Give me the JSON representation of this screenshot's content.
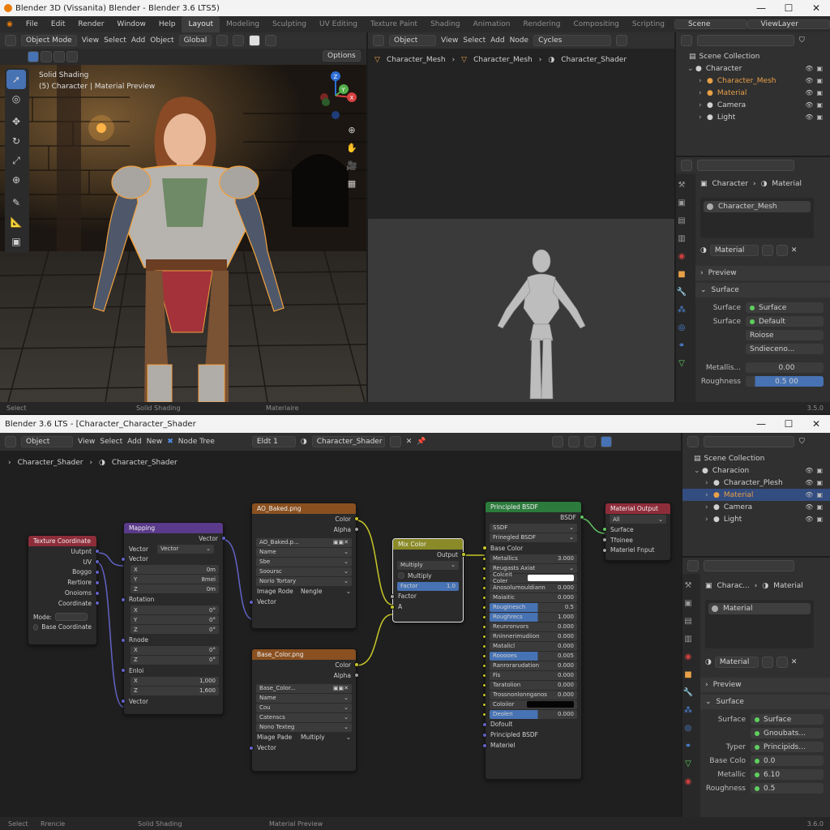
{
  "window1": {
    "title": "Blender 3D (Vissanita) Blender - Blender 3.6 LTS5)",
    "menu": [
      "File",
      "Edit",
      "Render",
      "Window",
      "Help"
    ],
    "workspaces": [
      "Layout",
      "Modeling",
      "Sculpting",
      "UV Editing",
      "Texture Paint",
      "Shading",
      "Animation",
      "Rendering",
      "Compositing",
      "Scripting"
    ],
    "scene": "Scene",
    "view_layer": "ViewLayer",
    "viewport": {
      "mode": "Object Mode",
      "menus": [
        "View",
        "Select",
        "Add",
        "Object"
      ],
      "transform": "Global",
      "options": "Options",
      "overlay_line1": "Solid Shading",
      "overlay_line2": "(5) Character | Material Preview",
      "gizmo_axes": [
        "Z",
        "Y",
        "X"
      ]
    },
    "shader_editor": {
      "mode": "Object",
      "menus": [
        "View",
        "Select",
        "Add",
        "Node"
      ],
      "engine": "Cycles",
      "breadcrumb": [
        "Character_Mesh",
        "Character_Mesh",
        "Character_Shader"
      ]
    },
    "outliner": {
      "title": "Scene Collection",
      "items": [
        {
          "label": "Character",
          "color": "#d0d0d0",
          "indent": 0
        },
        {
          "label": "Character_Mesh",
          "color": "#e8a048",
          "indent": 1
        },
        {
          "label": "Material",
          "color": "#e8a048",
          "indent": 1
        },
        {
          "label": "Camera",
          "color": "#d0d0d0",
          "indent": 1
        },
        {
          "label": "Light",
          "color": "#d0d0d0",
          "indent": 1
        }
      ]
    },
    "properties": {
      "breadcrumb": [
        "Character",
        "Material"
      ],
      "slot": "Character_Mesh",
      "material_name": "Material",
      "preview": "Preview",
      "surface_section": "Surface",
      "rows": [
        {
          "label": "Surface",
          "value": "Surface",
          "dot": true
        },
        {
          "label": "Surface",
          "value": "Default",
          "dot": true
        },
        {
          "label": "",
          "value": "Roiose",
          "dot": false
        },
        {
          "label": "",
          "value": "Sndieceno...",
          "dot": false
        }
      ],
      "metallic_label": "Metallis...",
      "metallic_value": "0.00",
      "roughness_label": "Roughness",
      "roughness_value": "0.5 00"
    },
    "status": {
      "left": "Select",
      "mid": "Solid Shading",
      "right": "Materiaire",
      "version": "3.5.0"
    }
  },
  "window2": {
    "title": "Blender 3.6 LTS - [Character_Character_Shader",
    "header": {
      "mode": "Object",
      "menus": [
        "View",
        "Select",
        "Add",
        "New"
      ],
      "node_tree": "Node Tree",
      "slot": "Eldt 1",
      "material": "Character_Shader"
    },
    "breadcrumb": [
      "Character_Shader",
      "Character_Shader"
    ],
    "nodes": {
      "texcoord": {
        "title": "Texture Coordinate",
        "outputs": [
          "Uutpnt",
          "UV",
          "Boggo",
          "Rertiore",
          "Onoioms",
          "Coordinate"
        ],
        "mode_label": "Mode:",
        "checkbox": "Base Coordinate"
      },
      "mapping": {
        "title": "Mapping",
        "out": "Vector",
        "type_label": "Vector",
        "type_value": "Vector",
        "vector_label": "Vector",
        "loc": [
          {
            "k": "X",
            "v": "0m"
          },
          {
            "k": "Y",
            "v": "8mei"
          },
          {
            "k": "Z",
            "v": "0m"
          }
        ],
        "rot_label": "Rotation",
        "rot": [
          {
            "k": "X",
            "v": "0°"
          },
          {
            "k": "Y",
            "v": "0°"
          },
          {
            "k": "Z",
            "v": "0°"
          }
        ],
        "scl_label": "Rnode",
        "scl": [
          {
            "k": "X",
            "v": "0°"
          },
          {
            "k": "Z",
            "v": "0°"
          }
        ],
        "extra_label": "Enloi",
        "extra": [
          {
            "k": "X",
            "v": "1,000"
          },
          {
            "k": "Z",
            "v": "1,600"
          }
        ],
        "in": "Vector"
      },
      "ao": {
        "title": "AO_Baked.png",
        "outputs": [
          "Color",
          "Alpha"
        ],
        "image": "AO_Baked.p...",
        "fields": [
          "Name",
          "Sbe",
          "Sooursc",
          "Norio Tortary"
        ],
        "proj_label": "Image Rode",
        "proj_value": "Nengle",
        "in": "Vector"
      },
      "base": {
        "title": "Base_Color.png",
        "outputs": [
          "Color",
          "Alpha"
        ],
        "image": "Base_Color...",
        "fields": [
          "Name",
          "Cou",
          "Catenscs",
          "Nono Texteg"
        ],
        "proj_label": "Miage Pade",
        "proj_value": "Multiply",
        "in": "Vector"
      },
      "mix": {
        "title": "Mix Color",
        "out": "Output",
        "blend": "Multiply",
        "clamp": "Multiply",
        "factor_label": "Factor",
        "factor_value": "1.0",
        "in_factor": "Factor",
        "in_a": "A"
      },
      "bsdf": {
        "title": "Principled BSDF",
        "out": "BSDF",
        "dist": "SSDF",
        "ss": "Frinegled BSDF",
        "rows": [
          {
            "k": "Base Color",
            "v": "",
            "t": "sock"
          },
          {
            "k": "Metallics",
            "v": "3.000",
            "t": "f"
          },
          {
            "k": "Reugasts Axiat",
            "v": "",
            "t": "d"
          },
          {
            "k": "Colceit Coler",
            "v": "",
            "t": "white"
          },
          {
            "k": "Anosolumouldiann",
            "v": "0.000",
            "t": "f"
          },
          {
            "k": "Maiaitic",
            "v": "0.000",
            "t": "f"
          },
          {
            "k": "Rouginesch",
            "v": "0.5",
            "t": "b"
          },
          {
            "k": "Roughrecs",
            "v": "1.000",
            "t": "b"
          },
          {
            "k": "Reunronvors",
            "v": "0.000",
            "t": "f"
          },
          {
            "k": "Rninnerimudiion",
            "v": "0.000",
            "t": "f"
          },
          {
            "k": "Matalicl",
            "v": "0.000",
            "t": "f"
          },
          {
            "k": "Rooooes",
            "v": "0.005",
            "t": "b"
          },
          {
            "k": "Ranrorarudation",
            "v": "0.000",
            "t": "f"
          },
          {
            "k": "Fis",
            "v": "0.000",
            "t": "f"
          },
          {
            "k": "Taratolion",
            "v": "0.000",
            "t": "f"
          },
          {
            "k": "Trossnonlonnganos",
            "v": "0.000",
            "t": "f"
          },
          {
            "k": "Coloiior",
            "v": "",
            "t": "black"
          },
          {
            "k": "Deolen",
            "v": "0.000",
            "t": "b"
          },
          {
            "k": "Dofoult",
            "v": "",
            "t": "sock"
          },
          {
            "k": "Principled BSDF",
            "v": "",
            "t": "sock"
          },
          {
            "k": "Materiel",
            "v": "",
            "t": "sock"
          }
        ]
      },
      "output": {
        "title": "Material Output",
        "target": "All",
        "inputs": [
          "Surface",
          "Tfoinee",
          "Materiel Fnput"
        ]
      }
    },
    "outliner": {
      "title": "Scene Collection",
      "items": [
        {
          "label": "Characion",
          "color": "#d0d0d0",
          "indent": 0
        },
        {
          "label": "Character_Plesh",
          "color": "#d0d0d0",
          "indent": 1
        },
        {
          "label": "Material",
          "color": "#e8a048",
          "indent": 1
        },
        {
          "label": "Camera",
          "color": "#d0d0d0",
          "indent": 1
        },
        {
          "label": "Light",
          "color": "#d0d0d0",
          "indent": 1
        }
      ]
    },
    "properties": {
      "breadcrumb": [
        "Charac...",
        "Material"
      ],
      "slot": "Material",
      "material_name": "Material",
      "preview": "Preview",
      "surface_section": "Surface",
      "rows": [
        {
          "label": "Surface",
          "value": "Surface",
          "dot": true
        },
        {
          "label": "",
          "value": "Gnoubats...",
          "dot": true
        },
        {
          "label": "Typer",
          "value": "Principids...",
          "dot": true
        },
        {
          "label": "Base Colo",
          "value": "0.0",
          "dot": true
        },
        {
          "label": "Metallic",
          "value": "6.10",
          "dot": true
        },
        {
          "label": "Roughness",
          "value": "0.5",
          "dot": true
        }
      ]
    },
    "status": {
      "left": "Select",
      "left2": "Rrencie",
      "mid": "Solid Shading",
      "right": "Material Preview",
      "version": "3.6.0"
    }
  }
}
